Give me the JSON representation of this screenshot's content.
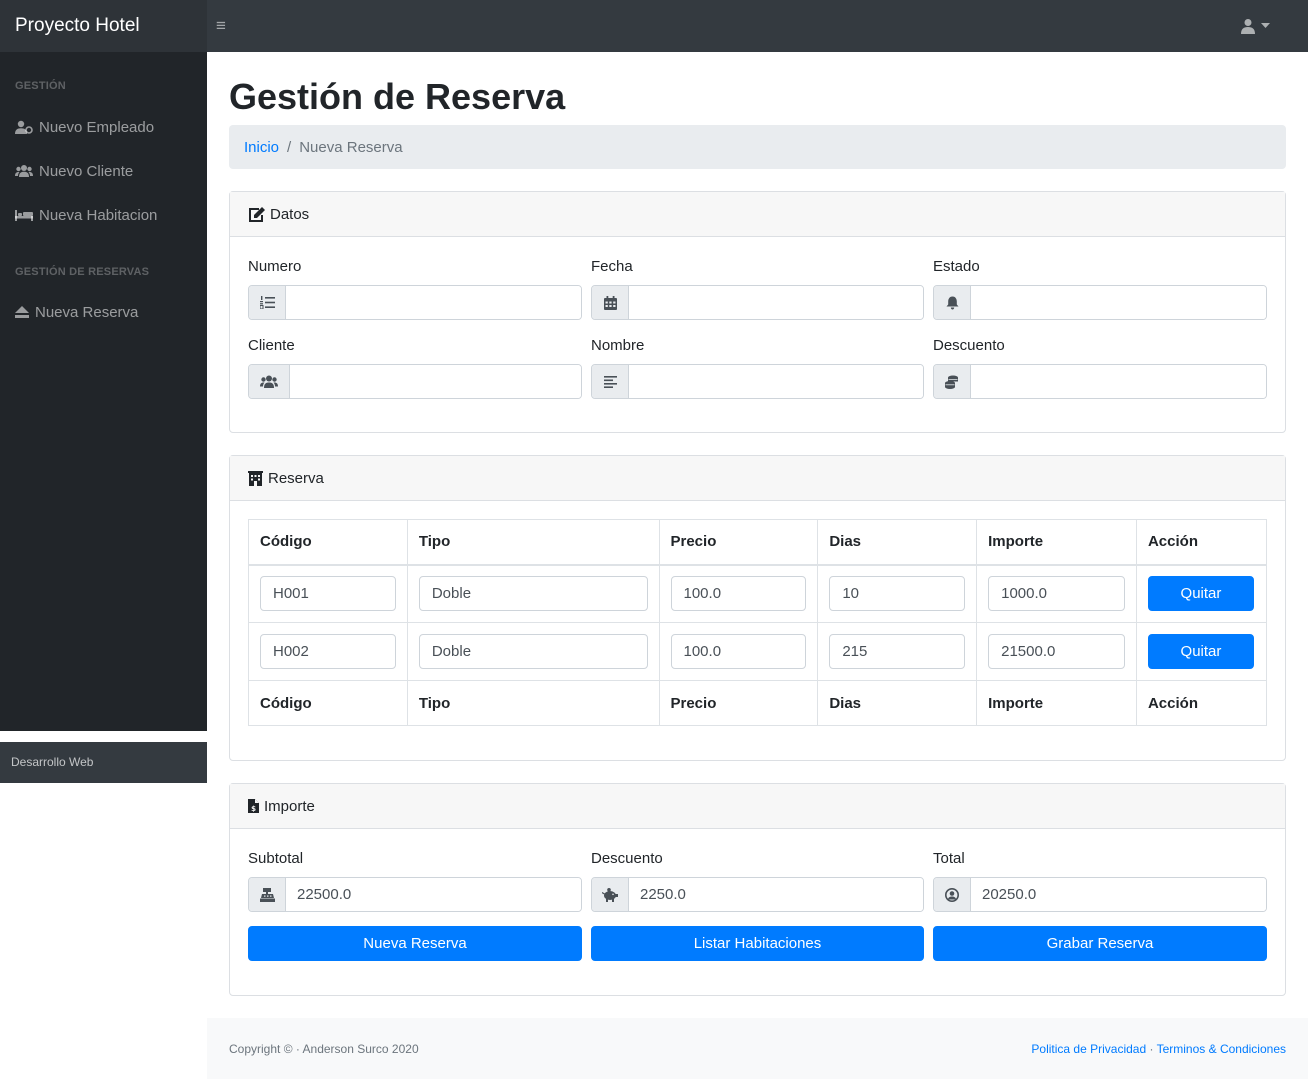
{
  "brand": "Proyecto Hotel",
  "sidebar": {
    "heading_gestion": "GESTIÓN",
    "items_gestion": [
      {
        "label": "Nuevo Empleado",
        "icon": "user-tie-icon"
      },
      {
        "label": "Nuevo Cliente",
        "icon": "users-icon"
      },
      {
        "label": "Nueva Habitacion",
        "icon": "bed-icon"
      }
    ],
    "heading_reservas": "GESTIÓN DE RESERVAS",
    "items_reservas": [
      {
        "label": "Nueva Reserva",
        "icon": "eject-icon"
      }
    ],
    "footer": "Desarrollo Web"
  },
  "page_title": "Gestión de Reserva",
  "breadcrumb": {
    "home": "Inicio",
    "separator": "/",
    "current": "Nueva Reserva"
  },
  "datos": {
    "header": "Datos",
    "fields": {
      "numero": {
        "label": "Numero",
        "value": ""
      },
      "fecha": {
        "label": "Fecha",
        "value": ""
      },
      "estado": {
        "label": "Estado",
        "value": ""
      },
      "cliente": {
        "label": "Cliente",
        "value": ""
      },
      "nombre": {
        "label": "Nombre",
        "value": ""
      },
      "descuento": {
        "label": "Descuento",
        "value": ""
      }
    }
  },
  "reserva": {
    "header": "Reserva",
    "columns": [
      "Código",
      "Tipo",
      "Precio",
      "Dias",
      "Importe",
      "Acción"
    ],
    "rows": [
      {
        "codigo": "H001",
        "tipo": "Doble",
        "precio": "100.0",
        "dias": "10",
        "importe": "1000.0",
        "accion": "Quitar"
      },
      {
        "codigo": "H002",
        "tipo": "Doble",
        "precio": "100.0",
        "dias": "215",
        "importe": "21500.0",
        "accion": "Quitar"
      }
    ]
  },
  "importe": {
    "header": "Importe",
    "subtotal": {
      "label": "Subtotal",
      "value": "22500.0"
    },
    "descuento": {
      "label": "Descuento",
      "value": "2250.0"
    },
    "total": {
      "label": "Total",
      "value": "20250.0"
    },
    "buttons": {
      "nueva": "Nueva Reserva",
      "listar": "Listar Habitaciones",
      "grabar": "Grabar Reserva"
    }
  },
  "footer": {
    "copyright": "Copyright © · Anderson Surco 2020",
    "privacy": "Politica de Privacidad",
    "dot": " · ",
    "terms": "Terminos & Condiciones"
  },
  "colors": {
    "primary": "#007bff",
    "navbar": "#343a40",
    "sidebar": "#212529"
  }
}
